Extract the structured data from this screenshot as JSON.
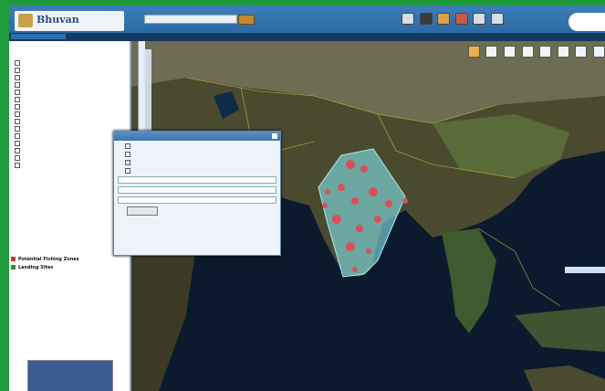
{
  "header": {
    "logo_text": "Bhuvan"
  },
  "legend": {
    "items": [
      {
        "label": "Potential Fishing Zones",
        "color": "#c23b2a"
      },
      {
        "label": "Landing Sites",
        "color": "#2d8b3a"
      }
    ]
  },
  "colors": {
    "header": "#3d7fb8",
    "map_ocean": "#0a1a2a",
    "aoi": "#7fd8e0",
    "hotspot": "#d9505a",
    "label": "#ffe46a"
  }
}
